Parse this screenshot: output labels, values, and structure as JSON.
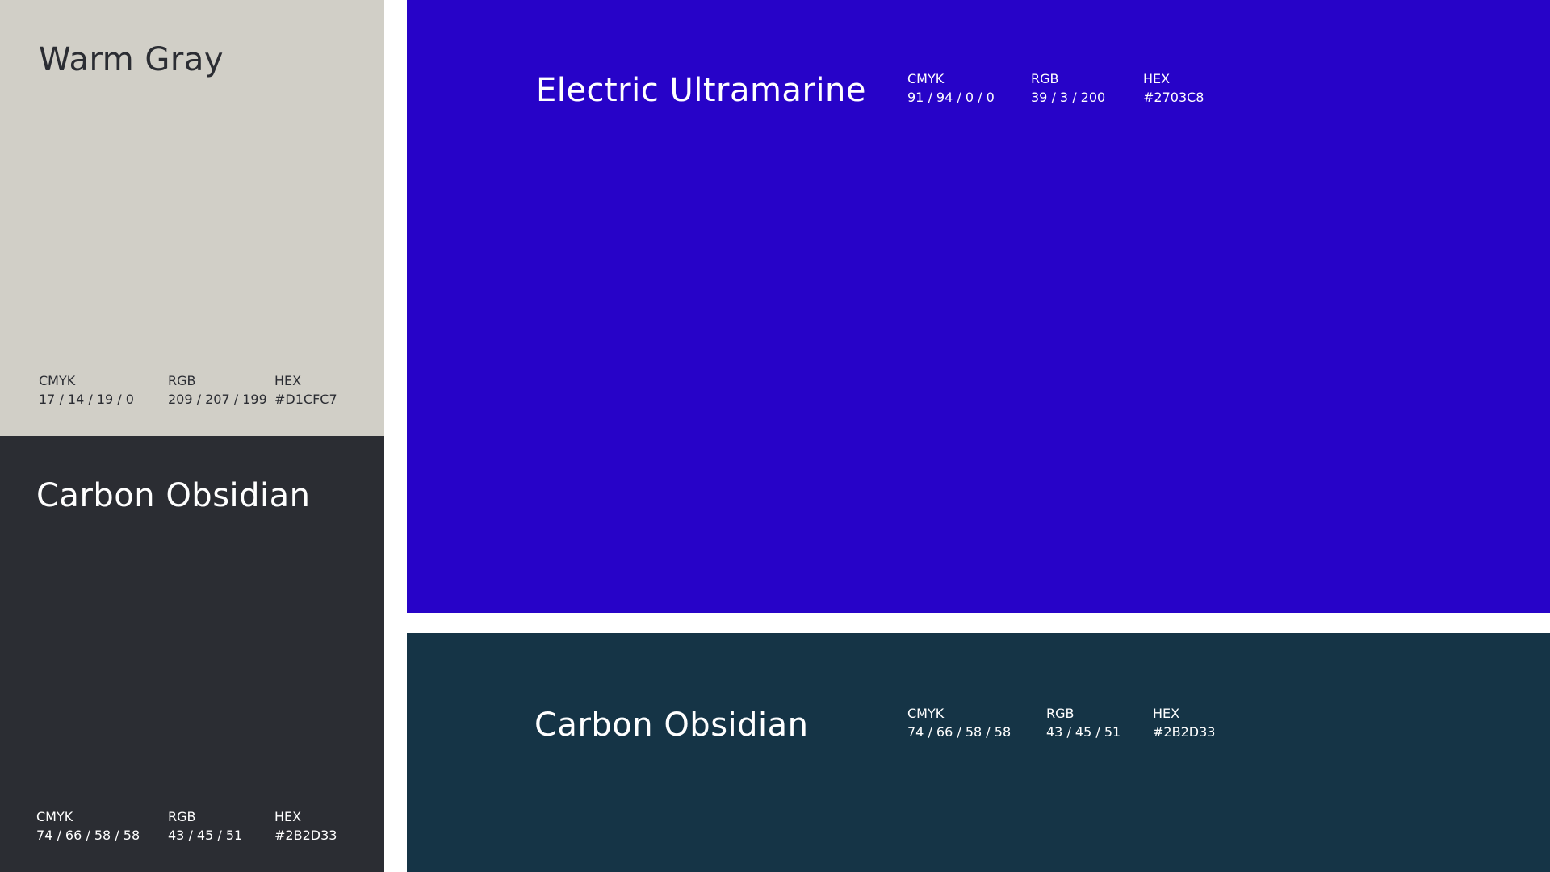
{
  "swatches": {
    "warm_gray": {
      "name": "Warm Gray",
      "background": "#D1CFC7",
      "text_color": "#2B2D33",
      "cmyk_label": "CMYK",
      "cmyk_value": "17 / 14 / 19 / 0",
      "rgb_label": "RGB",
      "rgb_value": "209 / 207 / 199",
      "hex_label": "HEX",
      "hex_value": "#D1CFC7"
    },
    "carbon_left": {
      "name": "Carbon Obsidian",
      "background": "#2B2D33",
      "text_color": "#FFFFFF",
      "cmyk_label": "CMYK",
      "cmyk_value": "74 / 66 / 58 / 58",
      "rgb_label": "RGB",
      "rgb_value": "43 / 45 / 51",
      "hex_label": "HEX",
      "hex_value": "#2B2D33"
    },
    "ultramarine": {
      "name": "Electric Ultramarine",
      "background": "#2703C8",
      "text_color": "#FFFFFF",
      "cmyk_label": "CMYK",
      "cmyk_value": "91 / 94 / 0 / 0",
      "rgb_label": "RGB",
      "rgb_value": "39 / 3 / 200",
      "hex_label": "HEX",
      "hex_value": "#2703C8"
    },
    "carbon_right": {
      "name": "Carbon Obsidian",
      "background": "#153446",
      "text_color": "#FFFFFF",
      "cmyk_label": "CMYK",
      "cmyk_value": "74 / 66 / 58 / 58",
      "rgb_label": "RGB",
      "rgb_value": "43 / 45 / 51",
      "hex_label": "HEX",
      "hex_value": "#2B2D33"
    }
  }
}
